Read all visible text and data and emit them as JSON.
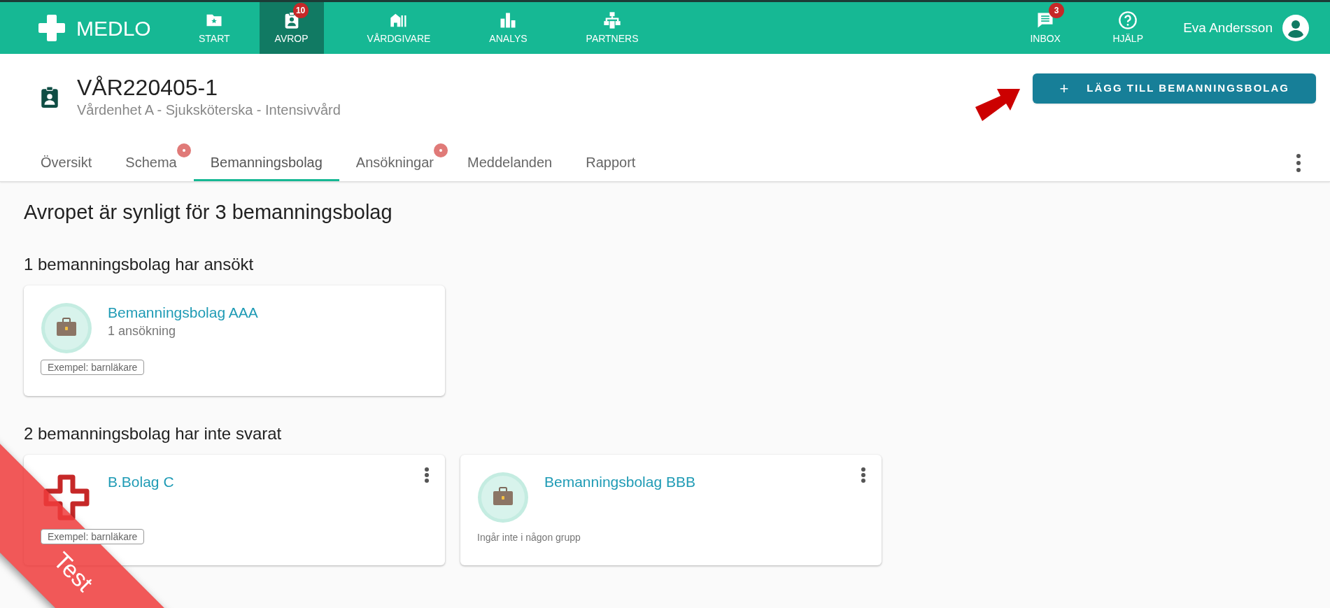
{
  "app": {
    "name": "MEDLO"
  },
  "nav": [
    {
      "label": "START",
      "selected": false
    },
    {
      "label": "AVROP",
      "selected": true,
      "count": "10"
    },
    {
      "label": "VÅRDGIVARE",
      "selected": false
    },
    {
      "label": "ANALYS",
      "selected": false
    },
    {
      "label": "PARTNERS",
      "selected": false
    }
  ],
  "nav_right": [
    {
      "label": "INBOX",
      "count": "3"
    },
    {
      "label": "HJÄLP"
    }
  ],
  "user": {
    "name": "Eva Andersson"
  },
  "page": {
    "title": "VÅR220405-1",
    "subtitle": "Vårdenhet A - Sjuksköterska - Intensivvård",
    "add_button": "LÄGG TILL BEMANNINGSBOLAG",
    "add_icon": "+"
  },
  "tabs": [
    {
      "label": "Översikt",
      "selected": false,
      "dot": false
    },
    {
      "label": "Schema",
      "selected": false,
      "dot": true
    },
    {
      "label": "Bemanningsbolag",
      "selected": true,
      "dot": false
    },
    {
      "label": "Ansökningar",
      "selected": false,
      "dot": true
    },
    {
      "label": "Meddelanden",
      "selected": false,
      "dot": false
    },
    {
      "label": "Rapport",
      "selected": false,
      "dot": false
    }
  ],
  "heading": "Avropet är synligt för 3 bemanningsbolag",
  "sections": [
    {
      "title": "1 bemanningsbolag har ansökt",
      "cards": [
        {
          "name": "Bemanningsbolag AAA",
          "detail": "1 ansökning",
          "kind": "briefcase",
          "tag": "Exempel: barnläkare",
          "menu": false
        }
      ]
    },
    {
      "title": "2 bemanningsbolag har inte svarat",
      "cards": [
        {
          "name": "B.Bolag C",
          "kind": "cross",
          "tag": "Exempel: barnläkare",
          "menu": true
        },
        {
          "name": "Bemanningsbolag BBB",
          "kind": "briefcase",
          "note": "Ingår inte i någon grupp",
          "menu": true
        }
      ]
    }
  ],
  "ribbon": {
    "label": "Test"
  }
}
